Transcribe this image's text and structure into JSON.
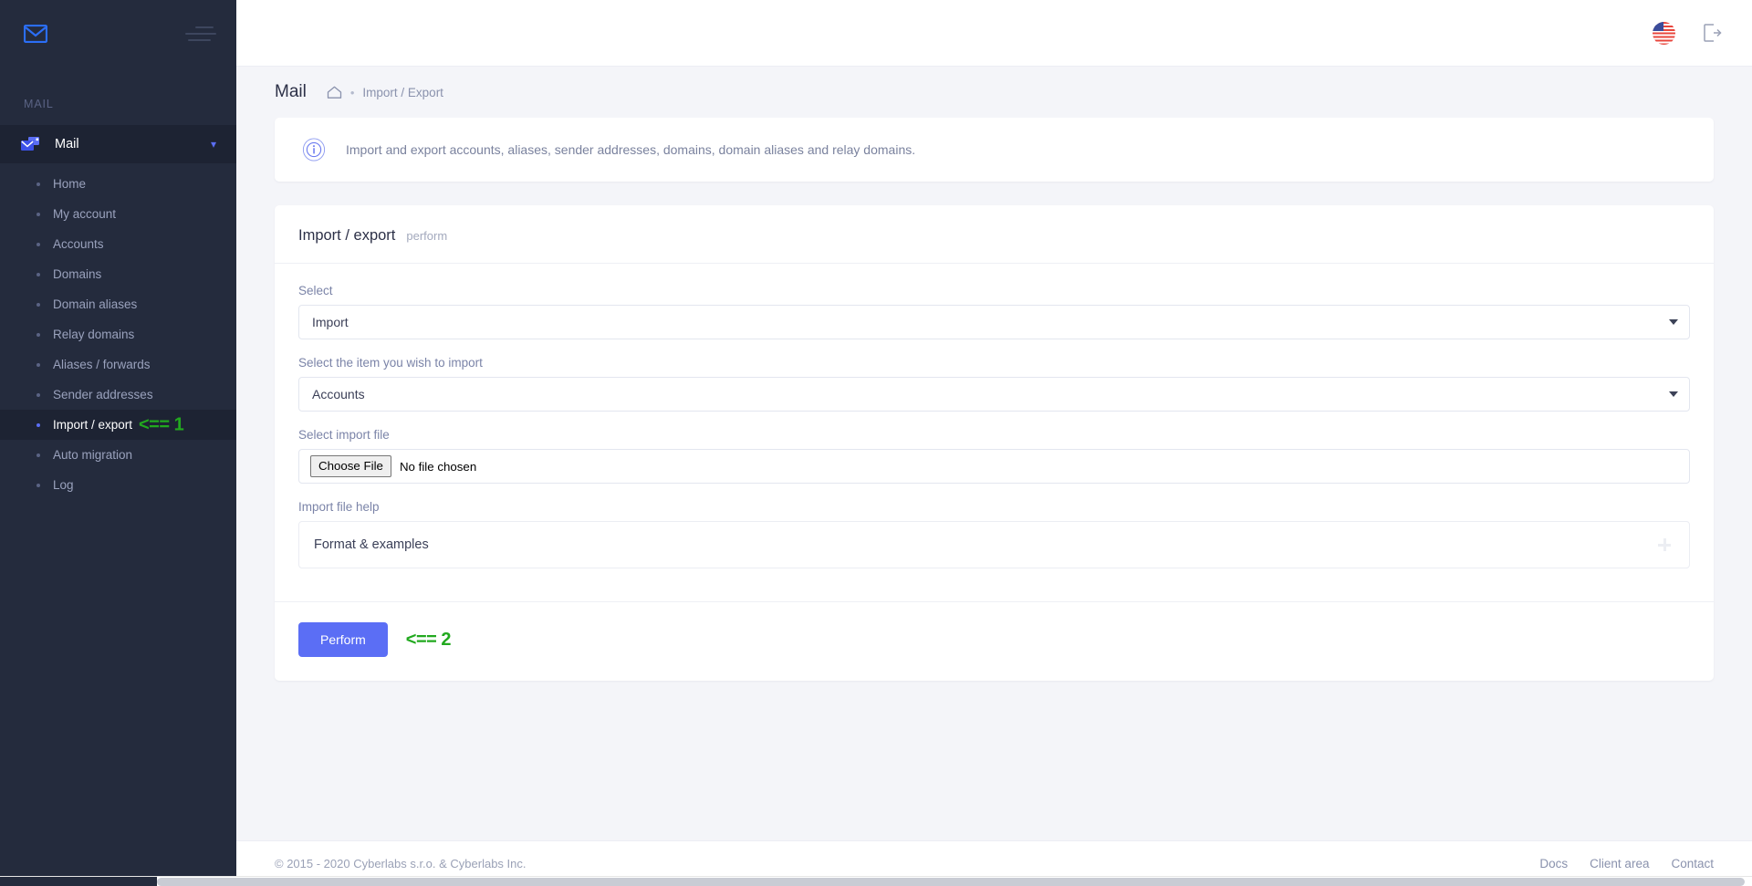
{
  "sidebar": {
    "logo_icon": "envelope-icon",
    "menu_toggle_icon": "hamburger-icon",
    "section_label": "MAIL",
    "group": {
      "label": "Mail",
      "icon": "mail-stack-icon",
      "chevron_icon": "chevron-down-icon"
    },
    "items": [
      {
        "label": "Home",
        "active": false
      },
      {
        "label": "My account",
        "active": false
      },
      {
        "label": "Accounts",
        "active": false
      },
      {
        "label": "Domains",
        "active": false
      },
      {
        "label": "Domain aliases",
        "active": false
      },
      {
        "label": "Relay domains",
        "active": false
      },
      {
        "label": "Aliases / forwards",
        "active": false
      },
      {
        "label": "Sender addresses",
        "active": false
      },
      {
        "label": "Import / export",
        "active": true
      },
      {
        "label": "Auto migration",
        "active": false
      },
      {
        "label": "Log",
        "active": false
      }
    ],
    "annotation": "<== 1"
  },
  "topbar": {
    "language_icon": "us-flag-icon",
    "logout_icon": "logout-icon"
  },
  "page": {
    "title": "Mail",
    "breadcrumb": {
      "home_icon": "home-icon",
      "separator": "•",
      "current": "Import / Export"
    }
  },
  "info_banner": {
    "icon": "info-circle-icon",
    "text": "Import and export accounts, aliases, sender addresses, domains, domain aliases and relay domains."
  },
  "form_card": {
    "title": "Import / export",
    "subtitle": "perform",
    "fields": {
      "select": {
        "label": "Select",
        "value": "Import",
        "caret_icon": "chevron-down-icon"
      },
      "item": {
        "label": "Select the item you wish to import",
        "value": "Accounts",
        "caret_icon": "chevron-down-icon"
      },
      "file": {
        "label": "Select import file",
        "button_label": "Choose File",
        "status": "No file chosen"
      },
      "help": {
        "label": "Import file help",
        "accordion_title": "Format & examples",
        "expand_icon": "plus-icon"
      }
    },
    "submit": {
      "label": "Perform",
      "annotation": "<== 2",
      "color": "#5b6ef5"
    }
  },
  "footer": {
    "copyright": "© 2015 - 2020 Cyberlabs s.r.o. & Cyberlabs Inc.",
    "links": [
      "Docs",
      "Client area",
      "Contact"
    ]
  },
  "colors": {
    "sidebar_bg": "#242b3d",
    "sidebar_active_bg": "#1d2333",
    "accent": "#5b6ef5",
    "annotation_green": "#22a91f",
    "page_bg": "#f4f5f9"
  }
}
